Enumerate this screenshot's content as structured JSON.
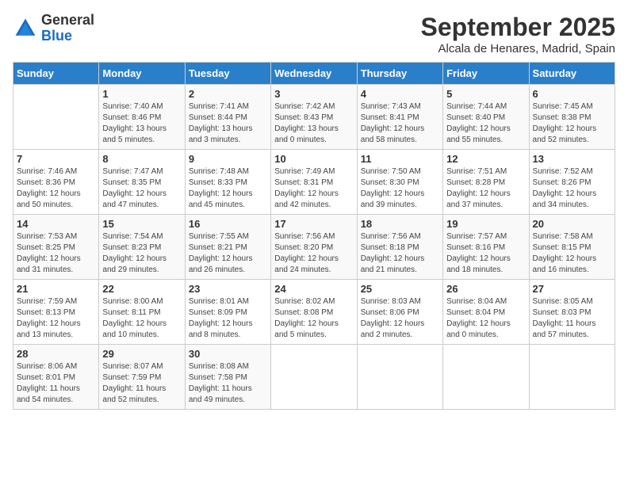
{
  "header": {
    "logo_general": "General",
    "logo_blue": "Blue",
    "month": "September 2025",
    "location": "Alcala de Henares, Madrid, Spain"
  },
  "columns": [
    "Sunday",
    "Monday",
    "Tuesday",
    "Wednesday",
    "Thursday",
    "Friday",
    "Saturday"
  ],
  "weeks": [
    [
      {
        "day": "",
        "info": ""
      },
      {
        "day": "1",
        "info": "Sunrise: 7:40 AM\nSunset: 8:46 PM\nDaylight: 13 hours\nand 5 minutes."
      },
      {
        "day": "2",
        "info": "Sunrise: 7:41 AM\nSunset: 8:44 PM\nDaylight: 13 hours\nand 3 minutes."
      },
      {
        "day": "3",
        "info": "Sunrise: 7:42 AM\nSunset: 8:43 PM\nDaylight: 13 hours\nand 0 minutes."
      },
      {
        "day": "4",
        "info": "Sunrise: 7:43 AM\nSunset: 8:41 PM\nDaylight: 12 hours\nand 58 minutes."
      },
      {
        "day": "5",
        "info": "Sunrise: 7:44 AM\nSunset: 8:40 PM\nDaylight: 12 hours\nand 55 minutes."
      },
      {
        "day": "6",
        "info": "Sunrise: 7:45 AM\nSunset: 8:38 PM\nDaylight: 12 hours\nand 52 minutes."
      }
    ],
    [
      {
        "day": "7",
        "info": "Sunrise: 7:46 AM\nSunset: 8:36 PM\nDaylight: 12 hours\nand 50 minutes."
      },
      {
        "day": "8",
        "info": "Sunrise: 7:47 AM\nSunset: 8:35 PM\nDaylight: 12 hours\nand 47 minutes."
      },
      {
        "day": "9",
        "info": "Sunrise: 7:48 AM\nSunset: 8:33 PM\nDaylight: 12 hours\nand 45 minutes."
      },
      {
        "day": "10",
        "info": "Sunrise: 7:49 AM\nSunset: 8:31 PM\nDaylight: 12 hours\nand 42 minutes."
      },
      {
        "day": "11",
        "info": "Sunrise: 7:50 AM\nSunset: 8:30 PM\nDaylight: 12 hours\nand 39 minutes."
      },
      {
        "day": "12",
        "info": "Sunrise: 7:51 AM\nSunset: 8:28 PM\nDaylight: 12 hours\nand 37 minutes."
      },
      {
        "day": "13",
        "info": "Sunrise: 7:52 AM\nSunset: 8:26 PM\nDaylight: 12 hours\nand 34 minutes."
      }
    ],
    [
      {
        "day": "14",
        "info": "Sunrise: 7:53 AM\nSunset: 8:25 PM\nDaylight: 12 hours\nand 31 minutes."
      },
      {
        "day": "15",
        "info": "Sunrise: 7:54 AM\nSunset: 8:23 PM\nDaylight: 12 hours\nand 29 minutes."
      },
      {
        "day": "16",
        "info": "Sunrise: 7:55 AM\nSunset: 8:21 PM\nDaylight: 12 hours\nand 26 minutes."
      },
      {
        "day": "17",
        "info": "Sunrise: 7:56 AM\nSunset: 8:20 PM\nDaylight: 12 hours\nand 24 minutes."
      },
      {
        "day": "18",
        "info": "Sunrise: 7:56 AM\nSunset: 8:18 PM\nDaylight: 12 hours\nand 21 minutes."
      },
      {
        "day": "19",
        "info": "Sunrise: 7:57 AM\nSunset: 8:16 PM\nDaylight: 12 hours\nand 18 minutes."
      },
      {
        "day": "20",
        "info": "Sunrise: 7:58 AM\nSunset: 8:15 PM\nDaylight: 12 hours\nand 16 minutes."
      }
    ],
    [
      {
        "day": "21",
        "info": "Sunrise: 7:59 AM\nSunset: 8:13 PM\nDaylight: 12 hours\nand 13 minutes."
      },
      {
        "day": "22",
        "info": "Sunrise: 8:00 AM\nSunset: 8:11 PM\nDaylight: 12 hours\nand 10 minutes."
      },
      {
        "day": "23",
        "info": "Sunrise: 8:01 AM\nSunset: 8:09 PM\nDaylight: 12 hours\nand 8 minutes."
      },
      {
        "day": "24",
        "info": "Sunrise: 8:02 AM\nSunset: 8:08 PM\nDaylight: 12 hours\nand 5 minutes."
      },
      {
        "day": "25",
        "info": "Sunrise: 8:03 AM\nSunset: 8:06 PM\nDaylight: 12 hours\nand 2 minutes."
      },
      {
        "day": "26",
        "info": "Sunrise: 8:04 AM\nSunset: 8:04 PM\nDaylight: 12 hours\nand 0 minutes."
      },
      {
        "day": "27",
        "info": "Sunrise: 8:05 AM\nSunset: 8:03 PM\nDaylight: 11 hours\nand 57 minutes."
      }
    ],
    [
      {
        "day": "28",
        "info": "Sunrise: 8:06 AM\nSunset: 8:01 PM\nDaylight: 11 hours\nand 54 minutes."
      },
      {
        "day": "29",
        "info": "Sunrise: 8:07 AM\nSunset: 7:59 PM\nDaylight: 11 hours\nand 52 minutes."
      },
      {
        "day": "30",
        "info": "Sunrise: 8:08 AM\nSunset: 7:58 PM\nDaylight: 11 hours\nand 49 minutes."
      },
      {
        "day": "",
        "info": ""
      },
      {
        "day": "",
        "info": ""
      },
      {
        "day": "",
        "info": ""
      },
      {
        "day": "",
        "info": ""
      }
    ]
  ]
}
